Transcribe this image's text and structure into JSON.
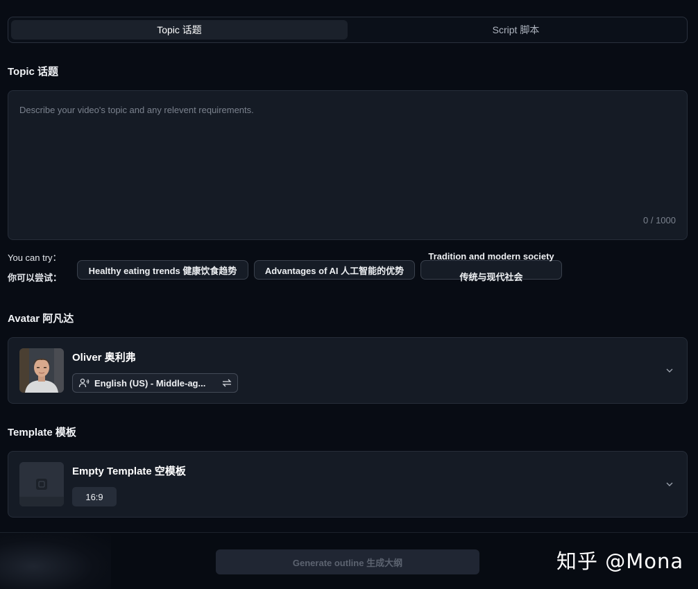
{
  "tabs": [
    {
      "label": "Topic  话题",
      "active": true
    },
    {
      "label": "Script  脚本",
      "active": false
    }
  ],
  "topic": {
    "label": "Topic  话题",
    "placeholder": "Describe your video's topic and any relevent requirements.",
    "value": "",
    "char_count": "0 / 1000"
  },
  "suggestions": {
    "label_en": "You can try：",
    "label_zh": "你可以尝试：",
    "chips": [
      {
        "label": "Healthy eating trends  健康饮食趋势"
      },
      {
        "label": "Advantages of AI  人工智能的优势"
      },
      {
        "label_line1": "Tradition and modern society",
        "label_line2": "传统与现代社会"
      }
    ]
  },
  "avatar": {
    "label": "Avatar  阿凡达",
    "name": "Oliver  奥利弗",
    "voice": "English (US) - Middle-ag...",
    "icons": {
      "voice": "voice-person-icon",
      "swap": "swap-icon",
      "expand": "chevron-down-icon"
    }
  },
  "template": {
    "label": "Template  模板",
    "name": "Empty Template  空模板",
    "ratio": "16:9",
    "icons": {
      "thumb": "video-placeholder-icon",
      "expand": "chevron-down-icon"
    }
  },
  "footer": {
    "generate_label": "Generate outline  生成大纲",
    "watermark": "知乎 @Mona"
  },
  "colors": {
    "background": "#080c14",
    "card": "#151b25",
    "border": "#262d39",
    "active_tab": "#1b212b",
    "button_disabled": "#202633"
  }
}
